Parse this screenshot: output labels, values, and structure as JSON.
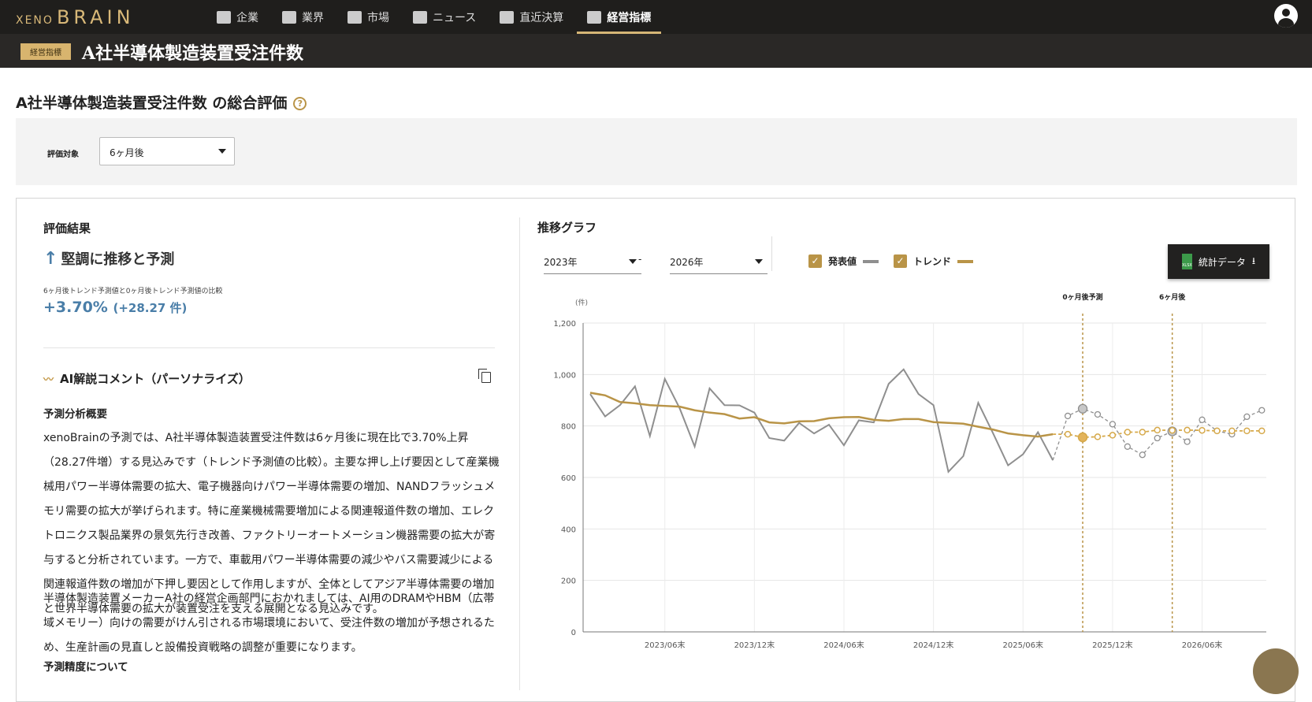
{
  "nav": {
    "logo_small": "XENO",
    "logo_big": "BRAIN",
    "tabs": [
      {
        "label": "企業",
        "icon": "building-icon"
      },
      {
        "label": "業界",
        "icon": "pie-chart-icon"
      },
      {
        "label": "市場",
        "icon": "line-chart-icon"
      },
      {
        "label": "ニュース",
        "icon": "newspaper-icon"
      },
      {
        "label": "直近決算",
        "icon": "bank-icon"
      },
      {
        "label": "経営指標",
        "icon": "badge-icon",
        "active": true
      }
    ]
  },
  "header": {
    "badge": "経営指標",
    "title": "A社半導体製造装置受注件数"
  },
  "section": {
    "title": "A社半導体製造装置受注件数 の総合評価",
    "help": "?"
  },
  "filter": {
    "label": "評価対象",
    "value": "6ヶ月後"
  },
  "result": {
    "heading": "評価結果",
    "arrow": "↑",
    "verdict": "堅調に推移と予測",
    "note": "6ヶ月後トレンド予測値と0ヶ月後トレンド予測値の比較",
    "pct": "+3.70%",
    "diff": "(+28.27 件)"
  },
  "ai": {
    "heading": "AI解説コメント（パーソナライズ）",
    "sub1": "予測分析概要",
    "p1": "xenoBrainの予測では、A社半導体製造装置受注件数は6ヶ月後に現在比で3.70%上昇（28.27件増）する見込みです（トレンド予測値の比較）。主要な押し上げ要因として産業機械用パワー半導体需要の拡大、電子機器向けパワー半導体需要の増加、NANDフラッシュメモリ需要の拡大が挙げられます。特に産業機械需要増加による関連報道件数の増加、エレクトロニクス製品業界の景気先行き改善、ファクトリーオートメーション機器需要の拡大が寄与すると分析されています。一方で、車載用パワー半導体需要の減少やバス需要減少による関連報道件数の増加が下押し要因として作用しますが、全体としてアジア半導体需要の増加と世界半導体需要の拡大が装置受注を支える展開となる見込みです。",
    "p2": "半導体製造装置メーカーA社の経営企画部門におかれましては、AI用のDRAMやHBM（広帯域メモリー）向けの需要がけん引される市場環境において、受注件数の増加が予想されるため、生産計画の見直しと設備投資戦略の調整が重要になります。",
    "sub2": "予測精度について"
  },
  "graph": {
    "heading": "推移グラフ",
    "from": "2023年",
    "sep": "-",
    "to": "2026年",
    "legend_actual": "発表値",
    "legend_trend": "トレンド",
    "download": "統計データ",
    "xlsx": "XLSX"
  },
  "colors": {
    "actual": "#8f8f8f",
    "trend": "#b99447",
    "forecast_trend": "#d6a94a",
    "accent": "#4a7ea8"
  },
  "chart_data": {
    "type": "line",
    "unit": "(件)",
    "ylim": [
      0,
      1200
    ],
    "yticks": [
      0,
      200,
      400,
      600,
      800,
      1000,
      1200
    ],
    "ytick_labels": [
      "0",
      "200",
      "400",
      "600",
      "800",
      "1,000",
      "1,200"
    ],
    "start_month": "2023/01",
    "xticks": [
      {
        "index": 5,
        "label": "2023/06末"
      },
      {
        "index": 11,
        "label": "2023/12末"
      },
      {
        "index": 17,
        "label": "2024/06末"
      },
      {
        "index": 23,
        "label": "2024/12末"
      },
      {
        "index": 29,
        "label": "2025/06末"
      },
      {
        "index": 35,
        "label": "2025/12末"
      },
      {
        "index": 41,
        "label": "2026/06末"
      }
    ],
    "markers": [
      {
        "index": 33,
        "label": "0ヶ月後予測"
      },
      {
        "index": 39,
        "label": "6ヶ月後"
      }
    ],
    "series": [
      {
        "name": "発表値",
        "values": [
          924,
          837,
          881,
          954,
          761,
          983,
          868,
          720,
          946,
          881,
          880,
          852,
          753,
          743,
          812,
          771,
          805,
          725,
          822,
          814,
          964,
          1020,
          924,
          881,
          622,
          683,
          890,
          771,
          647,
          690,
          776,
          667
        ]
      },
      {
        "name": "発表値予測",
        "start_index": 31,
        "values": [
          667,
          839,
          867,
          845,
          807,
          720,
          688,
          753,
          779,
          739,
          824,
          781,
          768,
          836,
          861
        ]
      },
      {
        "name": "トレンド",
        "values": [
          929,
          919,
          893,
          888,
          881,
          878,
          875,
          861,
          852,
          846,
          829,
          834,
          814,
          810,
          818,
          819,
          830,
          834,
          835,
          824,
          820,
          827,
          827,
          815,
          812,
          809,
          797,
          786,
          771,
          764,
          759,
          768
        ]
      },
      {
        "name": "トレンド予測",
        "start_index": 31,
        "values": [
          768,
          768,
          756,
          758,
          764,
          776,
          776,
          784,
          783,
          784,
          783,
          781,
          781,
          781,
          781
        ]
      }
    ]
  }
}
